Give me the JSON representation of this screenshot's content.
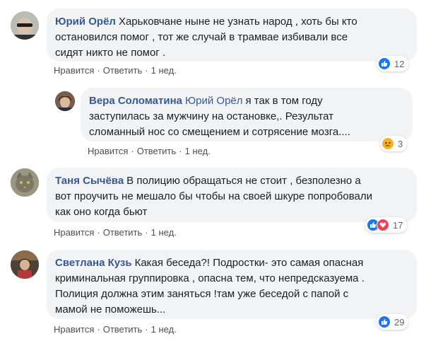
{
  "comments": [
    {
      "author": "Юрий Орёл",
      "text_lines": [
        "Харьковчане ныне не узнать народ , хоть бы кто",
        "остановился помог , тот же случай в трамвае избивали все",
        "сидят никто не помог ."
      ],
      "like_label": "Нравится",
      "reply_label": "Ответить",
      "time": "1 нед.",
      "reactions": [
        "like-icon"
      ],
      "reaction_count": "12"
    },
    {
      "author": "Вера Соломатина",
      "mention": "Юрий Орёл",
      "text_lines": [
        "я так в том году",
        "заступилась за мужчину на остановке,. Результат",
        "сломанный нос со смещением и сотрясение мозга...."
      ],
      "like_label": "Нравится",
      "reply_label": "Ответить",
      "time": "1 нед.",
      "reactions": [
        "sad-icon"
      ],
      "reaction_count": "3"
    },
    {
      "author": "Таня Сычёва",
      "text_lines": [
        "В полицию обращаться не стоит , безполезно а",
        "вот проучить не мешало бы чтобы на своей шкуре попробовали",
        "как оно когда бьют"
      ],
      "like_label": "Нравится",
      "reply_label": "Ответить",
      "time": "1 нед.",
      "reactions": [
        "like-icon",
        "love-icon"
      ],
      "reaction_count": "17"
    },
    {
      "author": "Светлана Кузь",
      "text_lines": [
        "Какая беседа?! Подростки- это самая опасная",
        "криминальная группировка , опасна тем, что непредсказуема .",
        "Полиция должна этим заняться !там уже беседой с папой с",
        "мамой не поможешь..."
      ],
      "like_label": "Нравится",
      "reply_label": "Ответить",
      "time": "1 нед.",
      "reactions": [
        "like-icon"
      ],
      "reaction_count": "29"
    }
  ],
  "colors": {
    "author": "#385898",
    "bubble": "#f2f3f5",
    "like": "#1877f2",
    "love": "#f33e58",
    "sad": "#f7b125"
  }
}
